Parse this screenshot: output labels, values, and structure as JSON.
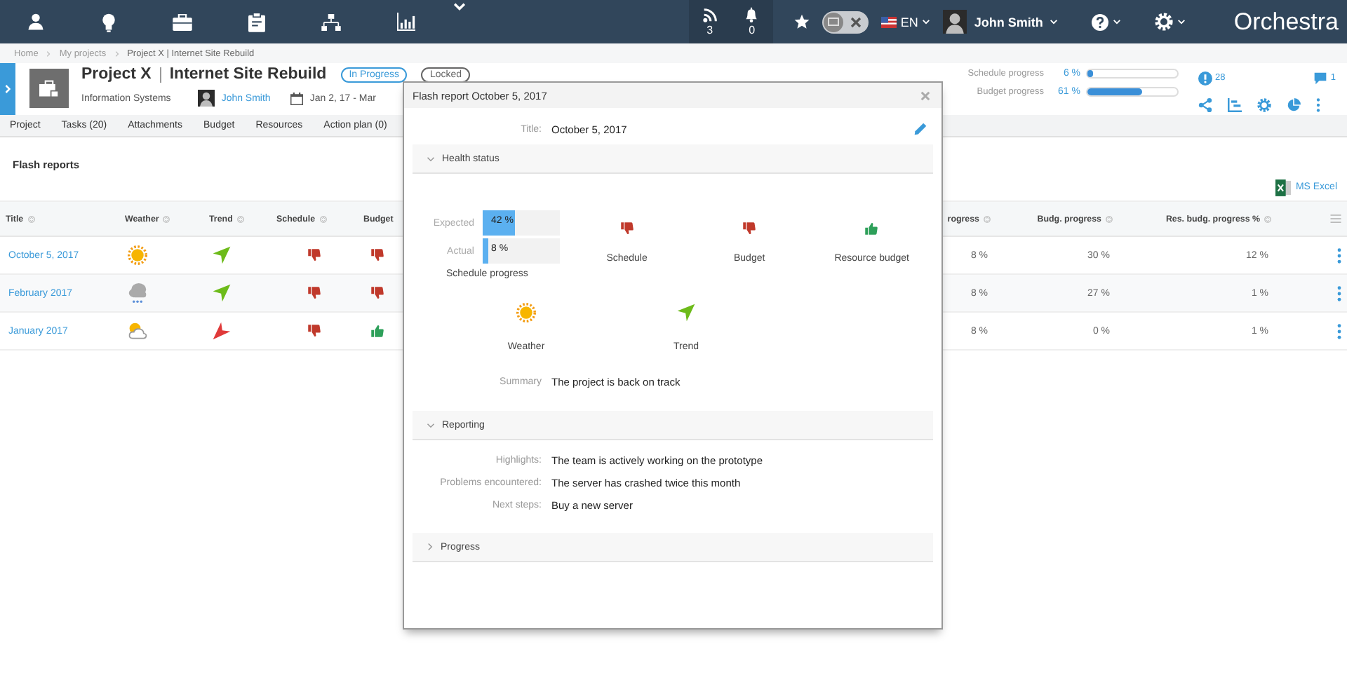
{
  "nav": {
    "feed_count": "3",
    "notifications_count": "0",
    "toggle": {
      "on": false
    },
    "language": "EN",
    "user": "John Smith",
    "brand": "Orchestra"
  },
  "breadcrumb": [
    "Home",
    "My projects",
    "Project X | Internet Site Rebuild"
  ],
  "project": {
    "name": "Project X",
    "title": "Internet Site Rebuild",
    "badges": [
      {
        "label": "In Progress",
        "kind": "status"
      },
      {
        "label": "Locked",
        "kind": "lock"
      }
    ],
    "department": "Information Systems",
    "manager": "John Smith",
    "dates": "Jan 2, 17 - Mar",
    "progress": [
      {
        "label": "Schedule progress",
        "reading": "6 %",
        "level": 0.06
      },
      {
        "label": "Budget progress",
        "reading": "61 %",
        "level": 0.61
      }
    ],
    "alerts_count": "28",
    "comments_count": "1"
  },
  "tabs": [
    {
      "label": "Project",
      "selected": false
    },
    {
      "label": "Tasks (20)",
      "selected": false
    },
    {
      "label": "Attachments",
      "selected": false
    },
    {
      "label": "Budget",
      "selected": false
    },
    {
      "label": "Resources",
      "selected": false
    },
    {
      "label": "Action plan (0)",
      "selected": false
    }
  ],
  "section_title": "Flash reports",
  "export_link": "MS Excel",
  "table": {
    "columns": [
      {
        "label": "Title",
        "sort_icon": true,
        "kind": "text"
      },
      {
        "label": "Weather",
        "sort_icon": true,
        "kind": "text"
      },
      {
        "label": "Trend",
        "sort_icon": true,
        "kind": "text"
      },
      {
        "label": "Schedule",
        "sort_icon": true,
        "kind": "text"
      },
      {
        "label": "Budget",
        "sort_icon": false,
        "kind": "text"
      },
      {
        "label": "rogress",
        "sort_icon": true,
        "kind": "number"
      },
      {
        "label": "Budg. progress",
        "sort_icon": true,
        "kind": "number"
      },
      {
        "label": "Res. budg. progress %",
        "sort_icon": true,
        "kind": "number"
      }
    ],
    "rows": [
      {
        "title": "October 5, 2017",
        "weather": {
          "kind": "sun"
        },
        "trend": {
          "kind": "up"
        },
        "schedule": {
          "kind": "down"
        },
        "budget": {
          "kind": "down"
        },
        "column_6": "8 %",
        "budg_progress": "30 %",
        "res_budg_progress": "12 %"
      },
      {
        "title": "February 2017",
        "weather": {
          "kind": "snow"
        },
        "trend": {
          "kind": "up"
        },
        "schedule": {
          "kind": "down"
        },
        "budget": {
          "kind": "down"
        },
        "column_6": "8 %",
        "budg_progress": "27 %",
        "res_budg_progress": "1 %"
      },
      {
        "title": "January 2017",
        "weather": {
          "kind": "partly_cloudy"
        },
        "trend": {
          "kind": "down"
        },
        "schedule": {
          "kind": "down"
        },
        "budget": {
          "kind": "up"
        },
        "column_6": "8 %",
        "budg_progress": "0 %",
        "res_budg_progress": "1 %"
      }
    ]
  },
  "modal": {
    "title": "Flash report October 5, 2017",
    "title_label": "Title:",
    "report_title": "October 5, 2017",
    "health": {
      "label": "Health status",
      "expanded": true,
      "bars": [
        {
          "label": "Expected",
          "reading": "42 %",
          "level": 0.42
        },
        {
          "label": "Actual",
          "reading": "8 %",
          "level": 0.08
        }
      ],
      "bars_caption": "Schedule progress",
      "indicators": [
        {
          "label": "Schedule",
          "kind": "thumb_down"
        },
        {
          "label": "Budget",
          "kind": "thumb_down"
        },
        {
          "label": "Resource budget",
          "kind": "thumb_up"
        },
        {
          "label": "Weather",
          "kind": "sun"
        },
        {
          "label": "Trend",
          "kind": "trend_up"
        }
      ],
      "summary_label": "Summary",
      "summary": "The project is back on track"
    },
    "reporting": {
      "label": "Reporting",
      "expanded": true,
      "fields": [
        {
          "label": "Highlights:",
          "value": "The team is actively working on the prototype"
        },
        {
          "label": "Problems encountered:",
          "value": "The server has crashed twice this month"
        },
        {
          "label": "Next steps:",
          "value": "Buy a new server"
        }
      ]
    },
    "progress": {
      "label": "Progress",
      "expanded": false
    }
  }
}
